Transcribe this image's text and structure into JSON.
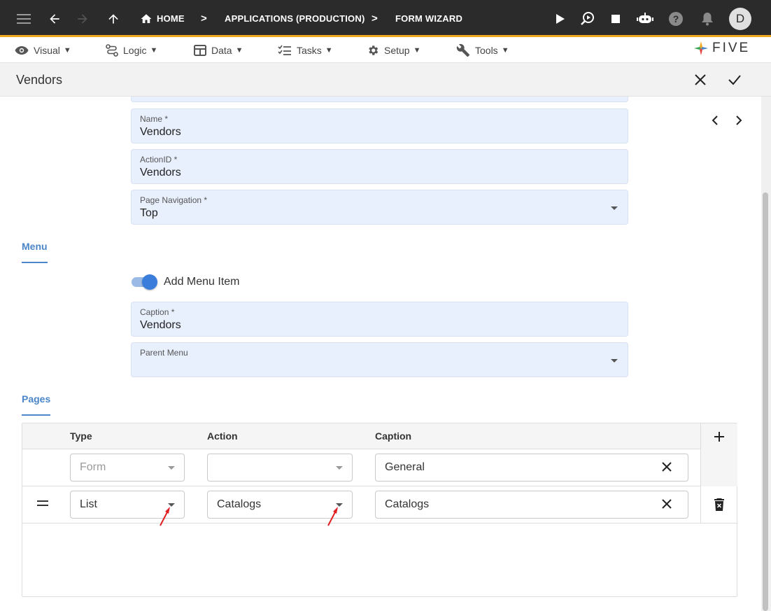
{
  "appbar": {
    "breadcrumbs": [
      "HOME",
      "APPLICATIONS (PRODUCTION)",
      "FORM WIZARD"
    ],
    "separator": ">",
    "avatar_initial": "D"
  },
  "menubar": {
    "items": [
      {
        "label": "Visual",
        "icon": "eye-icon"
      },
      {
        "label": "Logic",
        "icon": "logic-icon"
      },
      {
        "label": "Data",
        "icon": "table-icon"
      },
      {
        "label": "Tasks",
        "icon": "checklist-icon"
      },
      {
        "label": "Setup",
        "icon": "gear-icon"
      },
      {
        "label": "Tools",
        "icon": "tools-icon"
      }
    ],
    "caret": "▼",
    "logo_text": "FIVE"
  },
  "titlebar": {
    "title": "Vendors"
  },
  "form": {
    "name": {
      "label": "Name *",
      "value": "Vendors"
    },
    "action_id": {
      "label": "ActionID *",
      "value": "Vendors"
    },
    "page_navigation": {
      "label": "Page Navigation *",
      "value": "Top"
    }
  },
  "menu_section": {
    "title": "Menu",
    "toggle_label": "Add Menu Item",
    "toggle_on": true,
    "caption": {
      "label": "Caption *",
      "value": "Vendors"
    },
    "parent_menu": {
      "label": "Parent Menu",
      "value": ""
    }
  },
  "pages_section": {
    "title": "Pages",
    "columns": [
      "Type",
      "Action",
      "Caption"
    ],
    "rows": [
      {
        "type": "Form",
        "action": "",
        "caption": "General"
      },
      {
        "type": "List",
        "action": "Catalogs",
        "caption": "Catalogs"
      }
    ]
  },
  "colors": {
    "appbar_bg": "#2b2b2b",
    "accent_line": "#f0a81e",
    "section_accent": "#4a86c8",
    "field_bg": "#e8f0fe",
    "annotation_arrow": "#e02020"
  }
}
